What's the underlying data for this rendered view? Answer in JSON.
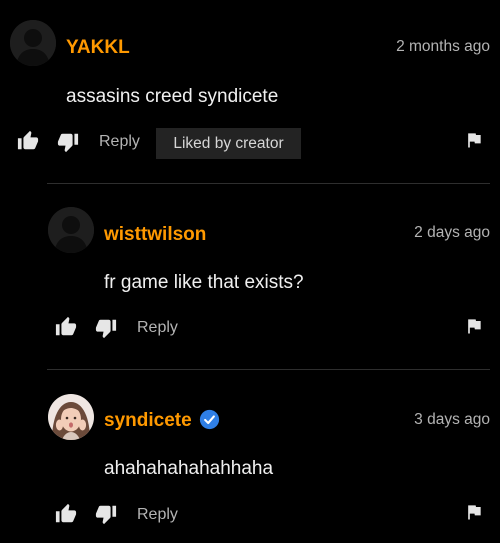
{
  "colors": {
    "background": "#000000",
    "username": "#ff9900",
    "text": "#f0f0f0",
    "muted": "#b3b3b3",
    "badge_bg": "#232323",
    "verified": "#2f7fe6"
  },
  "comments": [
    {
      "username": "YAKKL",
      "timestamp": "2 months ago",
      "text": "assasins creed syndicete",
      "reply_label": "Reply",
      "badge": "Liked by creator",
      "avatar": "default-avatar-icon"
    },
    {
      "username": "wisttwilson",
      "timestamp": "2 days ago",
      "text": "fr game like that exists?",
      "reply_label": "Reply",
      "avatar": "default-avatar-icon"
    },
    {
      "username": "syndicete",
      "timestamp": "3 days ago",
      "text": "ahahahahahahhaha",
      "reply_label": "Reply",
      "verified": true,
      "avatar": "profile-photo"
    }
  ],
  "icons": {
    "like": "thumbs-up-icon",
    "dislike": "thumbs-down-icon",
    "report": "flag-icon",
    "verified": "verified-check-icon"
  }
}
